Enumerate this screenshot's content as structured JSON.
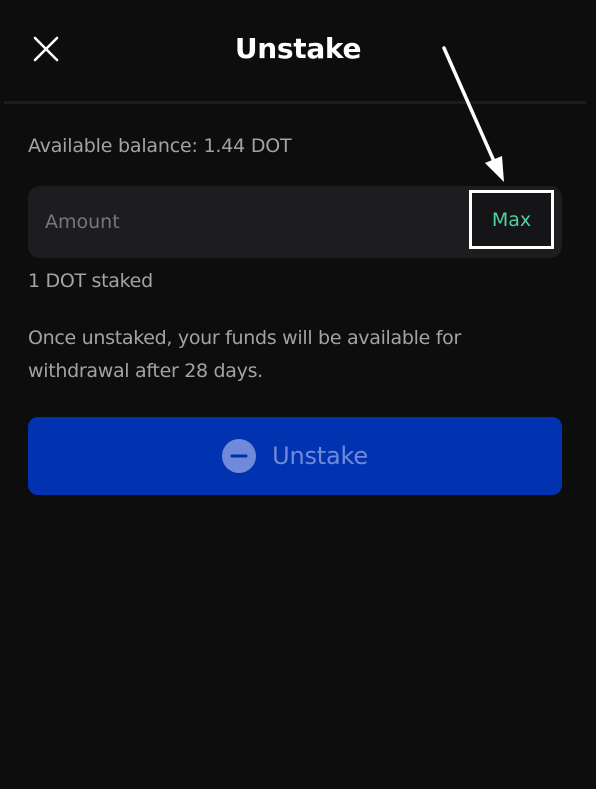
{
  "header": {
    "title": "Unstake",
    "close_icon": "close-icon"
  },
  "balance": {
    "text": "Available balance: 1.44 DOT"
  },
  "amount": {
    "placeholder": "Amount",
    "value": "",
    "max_label": "Max"
  },
  "staked": {
    "text": "1 DOT staked"
  },
  "info": {
    "text": "Once unstaked, your funds will be available for withdrawal after 28 days."
  },
  "action": {
    "label": "Unstake",
    "icon": "minus-circle-icon"
  },
  "colors": {
    "background": "#0d0d0e",
    "accent_green": "#4fd1a4",
    "button_blue": "#0133b0"
  }
}
